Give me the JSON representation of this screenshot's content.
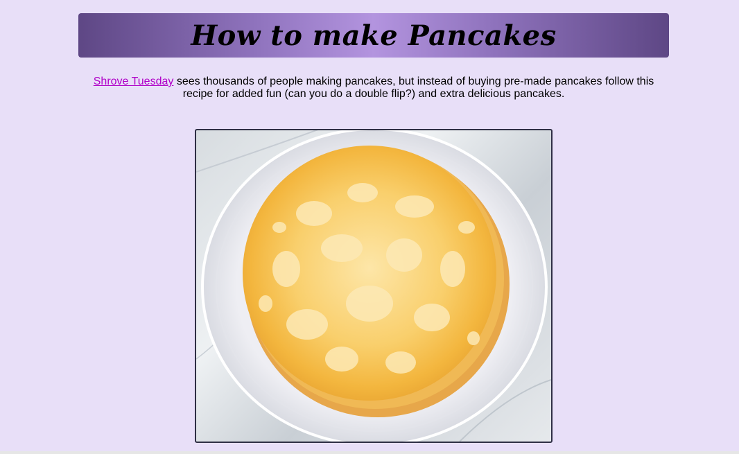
{
  "header": {
    "title": "How to make Pancakes"
  },
  "intro": {
    "link_text": "Shrove Tuesday",
    "body_text": " sees thousands of people making pancakes, but instead of buying pre-made pancakes follow this recipe for added fun (can you do a double flip?) and extra delicious pancakes."
  },
  "photo": {
    "subject": "stack of crepe pancakes on a white plate",
    "colors": {
      "pancake": "#f6c14b",
      "pancake_light": "#fde6a8",
      "plate": "#f4f4f8",
      "marble": "#dfe3e7"
    }
  },
  "colors": {
    "page_background": "#e8dff8",
    "banner_dark": "#5e4785",
    "banner_light": "#b394df",
    "link": "#b000c8"
  }
}
